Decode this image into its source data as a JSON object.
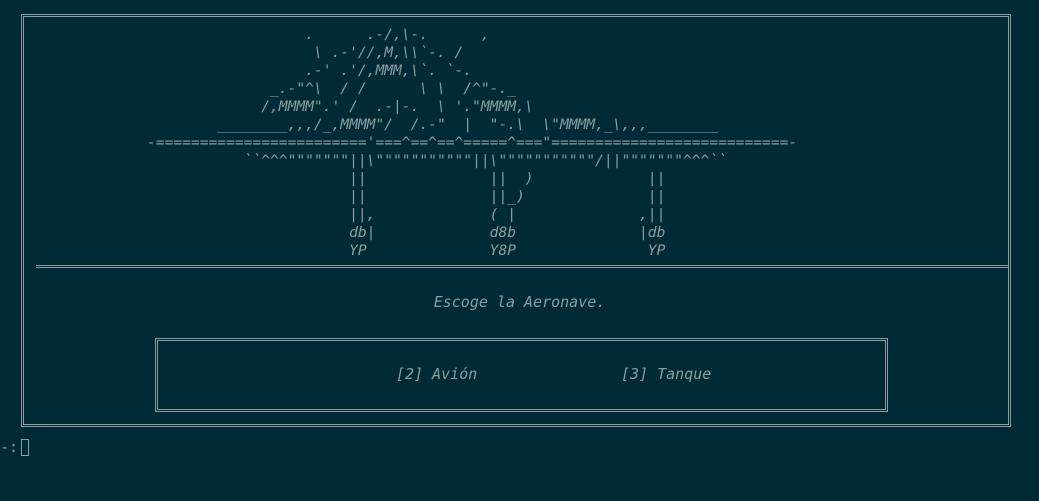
{
  "art": {
    "lines": [
      "                  .      .-/,\\-.      ,",
      "                   \\ .-'//,M,\\\\`-. /",
      "                  .-' .'/,MMM,\\`. `-.",
      "              _.-\"^\\  / /      \\ \\  /^\"-._",
      "             /,MMMM\".' /  .-|-.  \\ '.\"MMMM,\\",
      "        ________,,,/_,MMMM\"/  /.-\"  |  \"-.\\  \\\"MMMM,_\\,,,________",
      "-========================'===^==^==^=====^===\"===========================-",
      "           ``^^^\"\"\"\"\"\"\"||\\\"\"\"\"\"\"\"\"\"\"\"||\\\"\"\"\"\"\"\"\"\"\"\"/||\"\"\"\"\"\"\"^^^``",
      "                       ||              ||  )             ||",
      "                       ||              ||_)              ||",
      "                       ||,             ( |              ,||",
      "                       db|             d8b              |db",
      "                       YP              Y8P               YP"
    ]
  },
  "title": "Escoge la Aeronave.",
  "options": [
    {
      "label": "[2] Avión"
    },
    {
      "label": "[3] Tanque"
    }
  ],
  "command": {
    "prompt": "-:"
  }
}
